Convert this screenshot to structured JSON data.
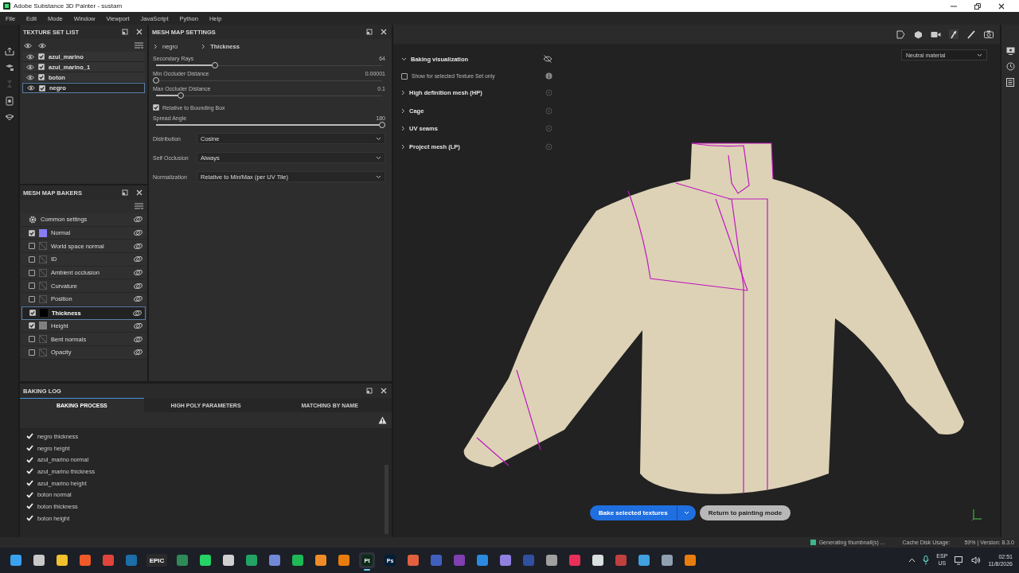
{
  "window": {
    "title": "Adobe Substance 3D Painter - sustam"
  },
  "menu": [
    "File",
    "Edit",
    "Mode",
    "Window",
    "Viewport",
    "JavaScript",
    "Python",
    "Help"
  ],
  "texture_set_list": {
    "title": "TEXTURE SET LIST",
    "items": [
      {
        "name": "azul_marino",
        "visible": true,
        "checked": true,
        "selected": false
      },
      {
        "name": "azul_marino_1",
        "visible": true,
        "checked": true,
        "selected": false
      },
      {
        "name": "boton",
        "visible": true,
        "checked": true,
        "selected": false
      },
      {
        "name": "negro",
        "visible": true,
        "checked": true,
        "selected": true
      }
    ]
  },
  "mesh_map_settings": {
    "title": "MESH MAP SETTINGS",
    "breadcrumb": [
      "negro",
      "Thickness"
    ],
    "fields": [
      {
        "kind": "slider",
        "label": "Secondary Rays",
        "reading": "64",
        "level": 0.26
      },
      {
        "kind": "slider",
        "label": "Min Occluder Distance",
        "reading": "0.00001",
        "level": 0
      },
      {
        "kind": "slider",
        "label": "Max Occluder Distance",
        "reading": "0.1",
        "level": 0.11
      },
      {
        "kind": "checkbox",
        "label": "Relative to Bounding Box",
        "checked": true
      },
      {
        "kind": "slider",
        "label": "Spread Angle",
        "reading": "180",
        "level": 1
      },
      {
        "kind": "dropdown",
        "label": "Distribution",
        "value": "Cosine"
      },
      {
        "kind": "dropdown",
        "label": "Self Occlusion",
        "value": "Always"
      },
      {
        "kind": "dropdown",
        "label": "Normalization",
        "value": "Relative to Min/Max (per UV Tile)"
      }
    ]
  },
  "mesh_map_bakers": {
    "title": "MESH MAP BAKERS",
    "items": [
      {
        "kind": "common",
        "label": "Common settings",
        "selected": false
      },
      {
        "kind": "map",
        "label": "Normal",
        "checked": true,
        "selected": false,
        "color": "#8a7cf8"
      },
      {
        "kind": "map",
        "label": "World space normal",
        "checked": false,
        "selected": false
      },
      {
        "kind": "map",
        "label": "ID",
        "checked": false,
        "selected": false
      },
      {
        "kind": "map",
        "label": "Ambient occlusion",
        "checked": false,
        "selected": false
      },
      {
        "kind": "map",
        "label": "Curvature",
        "checked": false,
        "selected": false
      },
      {
        "kind": "map",
        "label": "Position",
        "checked": false,
        "selected": false
      },
      {
        "kind": "map",
        "label": "Thickness",
        "checked": true,
        "selected": true,
        "color": "#000000"
      },
      {
        "kind": "map",
        "label": "Height",
        "checked": true,
        "selected": false,
        "color": "#808080"
      },
      {
        "kind": "map",
        "label": "Bent normals",
        "checked": false,
        "selected": false
      },
      {
        "kind": "map",
        "label": "Opacity",
        "checked": false,
        "selected": false
      }
    ]
  },
  "baking_log": {
    "title": "BAKING LOG",
    "tabs": [
      {
        "label": "BAKING PROCESS",
        "selected": true
      },
      {
        "label": "HIGH POLY PARAMETERS",
        "selected": false
      },
      {
        "label": "MATCHING BY NAME",
        "selected": false
      }
    ],
    "entries": [
      "negro thickness",
      "negro height",
      "azul_marino normal",
      "azul_marino thickness",
      "azul_marino height",
      "boton normal",
      "boton thickness",
      "boton height"
    ]
  },
  "viewport": {
    "panel": [
      {
        "kind": "section",
        "label": "Baking visualization",
        "expanded": true
      },
      {
        "kind": "checkbox",
        "label": "Show for selected Texture Set only",
        "checked": false
      },
      {
        "kind": "section",
        "label": "High definition mesh (HP)",
        "expanded": false
      },
      {
        "kind": "section",
        "label": "Cage",
        "expanded": false
      },
      {
        "kind": "section",
        "label": "UV seams",
        "expanded": false
      },
      {
        "kind": "section",
        "label": "Project mesh (LP)",
        "expanded": false
      }
    ],
    "material": "Neutral material",
    "bake_button": "Bake selected textures",
    "return_button": "Return to painting mode"
  },
  "status_bar": {
    "message": "Generating thumbnail(s) ...",
    "cache": "Cache Disk Usage:",
    "usage": "59% | Version: 8.3.0"
  },
  "taskbar": {
    "apps": [
      {
        "color": "#3aa0f0",
        "selected": false
      },
      {
        "color": "#c8c8c8",
        "selected": false
      },
      {
        "color": "#f2c12e",
        "selected": false
      },
      {
        "color": "#f05a28",
        "selected": false
      },
      {
        "color": "#e0443a",
        "selected": false
      },
      {
        "color": "#1b6ea8",
        "selected": false
      },
      {
        "label": "EPIC",
        "color": "#2a2a2a",
        "selected": false
      },
      {
        "color": "#2e8b57",
        "selected": false
      },
      {
        "color": "#25d366",
        "selected": false
      },
      {
        "color": "#d0d0d0",
        "selected": false
      },
      {
        "color": "#21a366",
        "selected": false
      },
      {
        "color": "#7289da",
        "selected": false
      },
      {
        "color": "#1db954",
        "selected": false
      },
      {
        "color": "#f08c28",
        "selected": false
      },
      {
        "color": "#e87d0d",
        "selected": false
      },
      {
        "label": "Pt",
        "color": "#0e2a1a",
        "selected": true
      },
      {
        "label": "Ps",
        "color": "#001e36",
        "selected": false
      },
      {
        "color": "#e06040",
        "selected": false
      },
      {
        "color": "#4060c0",
        "selected": false
      },
      {
        "color": "#8040b0",
        "selected": false
      },
      {
        "color": "#2a8ae0",
        "selected": false
      },
      {
        "color": "#9080e0",
        "selected": false
      },
      {
        "color": "#3050a0",
        "selected": false
      },
      {
        "color": "#a0a0a0",
        "selected": false
      },
      {
        "color": "#e8305a",
        "selected": false
      },
      {
        "color": "#d8e0e0",
        "selected": false
      },
      {
        "color": "#c04040",
        "selected": false
      },
      {
        "color": "#40a0e0",
        "selected": false
      },
      {
        "color": "#90a0b0",
        "selected": false
      },
      {
        "color": "#e87d0d",
        "selected": false
      }
    ],
    "language": [
      "ESP",
      "US"
    ],
    "time": "02:51",
    "date": "11/8/2026"
  }
}
